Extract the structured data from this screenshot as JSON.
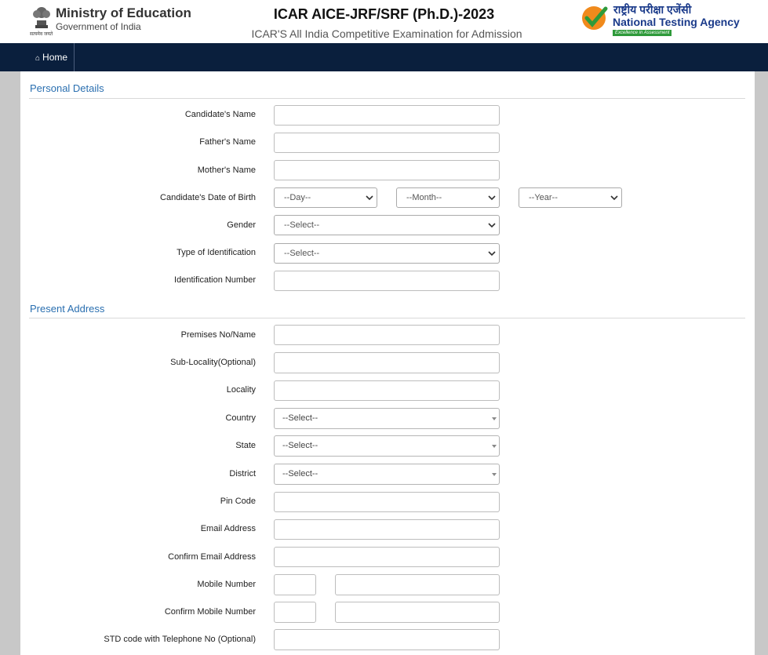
{
  "header": {
    "ministry_title": "Ministry of Education",
    "ministry_subtitle": "Government of India",
    "emblem_caption": "सत्यमेव जयते",
    "exam_title": "ICAR AICE-JRF/SRF (Ph.D.)-2023",
    "exam_subtitle": "ICAR'S All India Competitive Examination for Admission",
    "agency_hindi": "राष्ट्रीय परीक्षा एजेंसी",
    "agency_name": "National Testing Agency",
    "agency_tagline": "Excellence in Assessment"
  },
  "nav": {
    "home_label": "Home"
  },
  "personal": {
    "heading": "Personal Details",
    "candidate_name": "Candidate's Name",
    "father_name": "Father's Name",
    "mother_name": "Mother's Name",
    "dob": "Candidate's Date of Birth",
    "dob_day": "--Day--",
    "dob_month": "--Month--",
    "dob_year": "--Year--",
    "gender": "Gender",
    "gender_value": "--Select--",
    "id_type": "Type of Identification",
    "id_type_value": "--Select--",
    "id_number": "Identification Number"
  },
  "address": {
    "heading": "Present Address",
    "premises": "Premises No/Name",
    "sub_locality": "Sub-Locality(Optional)",
    "locality": "Locality",
    "country": "Country",
    "country_value": "--Select--",
    "state": "State",
    "state_value": "--Select--",
    "district": "District",
    "district_value": "--Select--",
    "pin": "Pin Code",
    "email": "Email Address",
    "confirm_email": "Confirm Email Address",
    "mobile": "Mobile Number",
    "confirm_mobile": "Confirm Mobile Number",
    "telephone": "STD code with Telephone No (Optional)"
  },
  "colors": {
    "navbar": "#0a1f3d",
    "section_heading": "#2a6fb0",
    "background": "#c8c8c8"
  }
}
